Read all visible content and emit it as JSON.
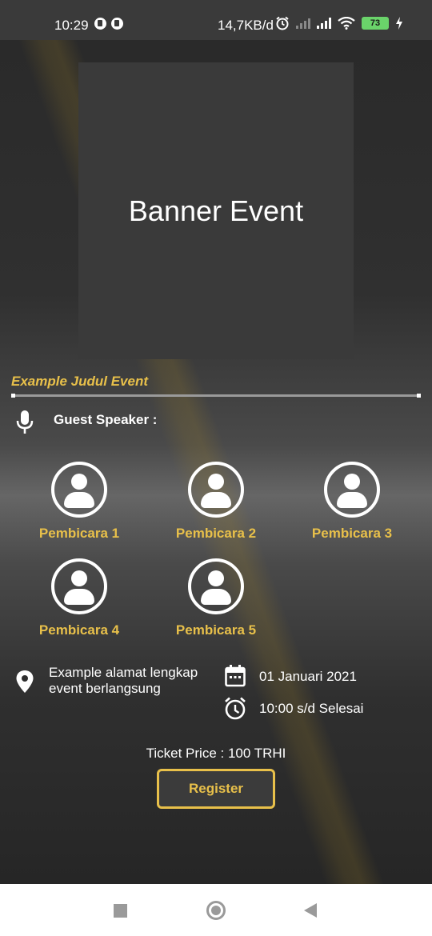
{
  "status_bar": {
    "time": "10:29",
    "network_speed": "14,7KB/d",
    "battery_level": "73",
    "icons": [
      "notification-icon",
      "notification-icon",
      "alarm-icon",
      "signal-icon",
      "signal-icon",
      "wifi-icon",
      "battery-icon",
      "charging-icon"
    ]
  },
  "banner": {
    "label": "Banner Event"
  },
  "event": {
    "title": "Example Judul Event",
    "guest_label": "Guest Speaker :",
    "speakers": [
      {
        "name": "Pembicara 1"
      },
      {
        "name": "Pembicara 2"
      },
      {
        "name": "Pembicara 3"
      },
      {
        "name": "Pembicara 4"
      },
      {
        "name": "Pembicara 5"
      }
    ],
    "address": "Example alamat lengkap event berlangsung",
    "date": "01 Januari 2021",
    "time": "10:00 s/d Selesai",
    "ticket_price": "Ticket Price : 100  TRHI",
    "register_label": "Register"
  },
  "colors": {
    "accent": "#e8c04a",
    "background": "#2a2a2a",
    "banner": "#3a3a3a",
    "text": "#ffffff"
  }
}
